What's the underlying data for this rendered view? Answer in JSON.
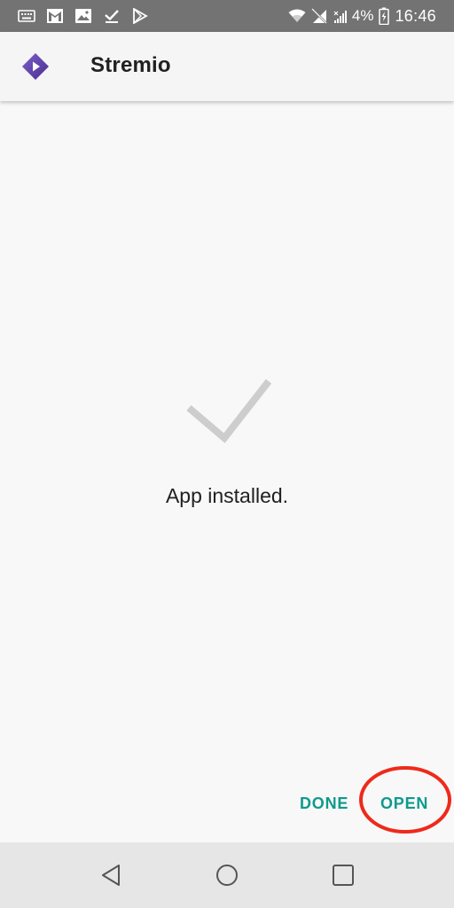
{
  "status_bar": {
    "battery_percent": "4%",
    "time": "16:46",
    "left_icons": [
      "keyboard-icon",
      "gmail-icon",
      "image-icon",
      "checkmark-icon",
      "play-store-icon"
    ],
    "right_icons": [
      "wifi-icon",
      "no-signal-icon",
      "signal-icon",
      "battery-charging-icon"
    ]
  },
  "app_bar": {
    "title": "Stremio",
    "icon": "stremio-logo-icon",
    "icon_colors": [
      "#7b5ec9",
      "#4b2e91"
    ]
  },
  "content": {
    "status_icon": "checkmark-icon",
    "message": "App installed."
  },
  "actions": {
    "done_label": "DONE",
    "open_label": "OPEN",
    "accent_color": "#0e9a8c",
    "highlight_color": "#ee2a1b"
  },
  "nav_bar": {
    "buttons": [
      "back-icon",
      "home-icon",
      "recents-icon"
    ]
  }
}
